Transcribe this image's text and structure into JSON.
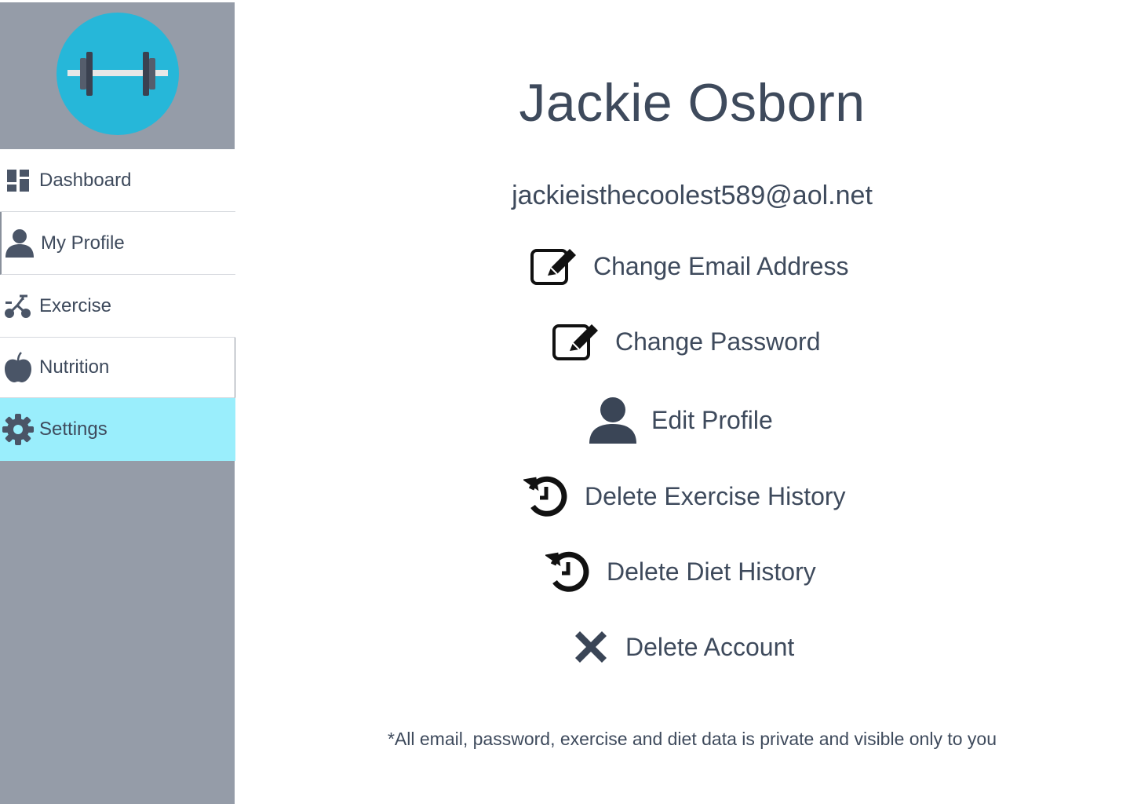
{
  "sidebar": {
    "logo": {
      "icon": "dumbbell-icon",
      "circle_color": "#26b7d9"
    },
    "items": [
      {
        "label": "Dashboard",
        "icon": "dashboard-icon"
      },
      {
        "label": "My Profile",
        "icon": "user-icon"
      },
      {
        "label": "Exercise",
        "icon": "bike-icon"
      },
      {
        "label": "Nutrition",
        "icon": "apple-icon"
      },
      {
        "label": "Settings",
        "icon": "gear-icon",
        "active": true
      }
    ]
  },
  "profile": {
    "name": "Jackie Osborn",
    "email": "jackieisthecoolest589@aol.net"
  },
  "actions": [
    {
      "label": "Change Email Address",
      "icon": "edit-icon"
    },
    {
      "label": "Change Password",
      "icon": "edit-icon"
    },
    {
      "label": "Edit Profile",
      "icon": "user-icon"
    },
    {
      "label": "Delete Exercise History",
      "icon": "history-icon"
    },
    {
      "label": "Delete Diet History",
      "icon": "history-icon"
    },
    {
      "label": "Delete Account",
      "icon": "close-icon"
    }
  ],
  "footnote": "*All email, password, exercise and diet data is private and visible only to you",
  "colors": {
    "sidebar_bg": "#959ca8",
    "active_bg": "#9aeefc",
    "text": "#3e4a5c"
  }
}
